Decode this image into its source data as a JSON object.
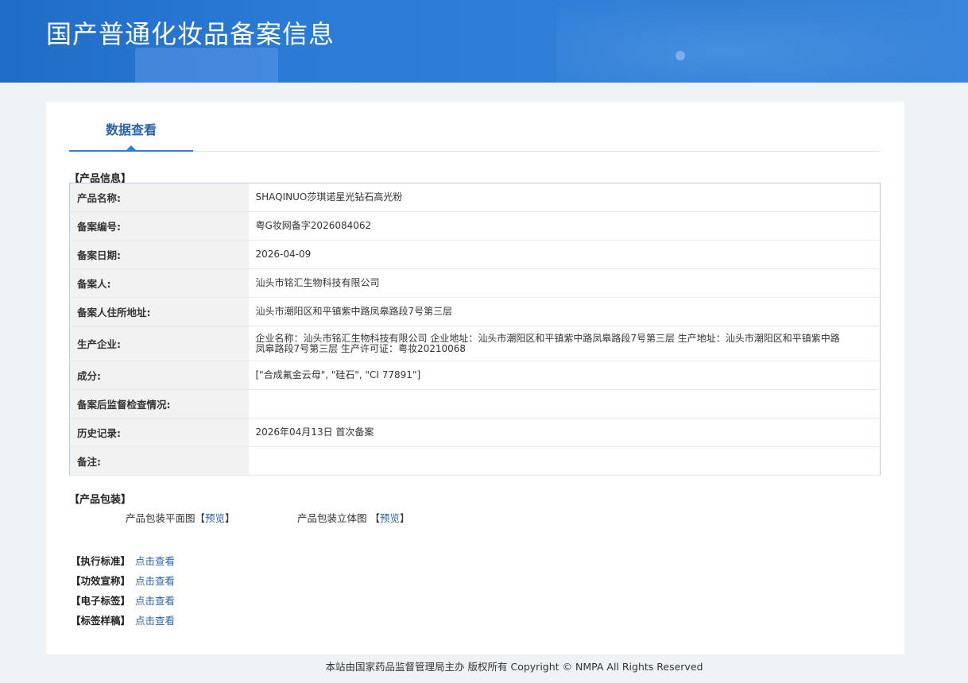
{
  "header": {
    "title": "国产普通化妆品备案信息"
  },
  "tab": {
    "label": "数据查看"
  },
  "sections": {
    "product_info": "【产品信息】",
    "product_packaging": "【产品包装】"
  },
  "product_info": [
    {
      "label": "产品名称:",
      "value": "SHAQINUO莎琪诺星光钻石高光粉"
    },
    {
      "label": "备案编号:",
      "value": "粤G妆网备字2026084062"
    },
    {
      "label": "备案日期:",
      "value": "2026-04-09"
    },
    {
      "label": "备案人:",
      "value": "汕头市铭汇生物科技有限公司"
    },
    {
      "label": "备案人住所地址:",
      "value": "汕头市潮阳区和平镇紫中路凤皋路段7号第三层"
    },
    {
      "label": "生产企业:",
      "value": "企业名称：汕头市铭汇生物科技有限公司 企业地址：汕头市潮阳区和平镇紫中路凤皋路段7号第三层 生产地址：汕头市潮阳区和平镇紫中路凤皋路段7号第三层 生产许可证：粤妆20210068"
    },
    {
      "label": "成分:",
      "value": "[\"合成氟金云母\", \"硅石\", \"CI 77891\"]"
    },
    {
      "label": "备案后监督检查情况:",
      "value": ""
    },
    {
      "label": "历史记录:",
      "value": "2026年04月13日 首次备案"
    },
    {
      "label": "备注:",
      "value": ""
    }
  ],
  "packaging": {
    "flat_label": "产品包装平面图",
    "solid_label": "产品包装立体图",
    "preview_link": "预览",
    "bracket_open": "【",
    "bracket_close": "】"
  },
  "links": [
    {
      "label": "【执行标准】",
      "link": "点击查看"
    },
    {
      "label": "【功效宣称】",
      "link": "点击查看"
    },
    {
      "label": "【电子标签】",
      "link": "点击查看"
    },
    {
      "label": "【标签样稿】",
      "link": "点击查看"
    }
  ],
  "footer": {
    "text": "本站由国家药品监督管理局主办 版权所有 Copyright © NMPA All Rights Reserved"
  },
  "colors": {
    "banner": "#2f7ed8",
    "link": "#2a64a8",
    "tab_text": "#2a64a8"
  }
}
